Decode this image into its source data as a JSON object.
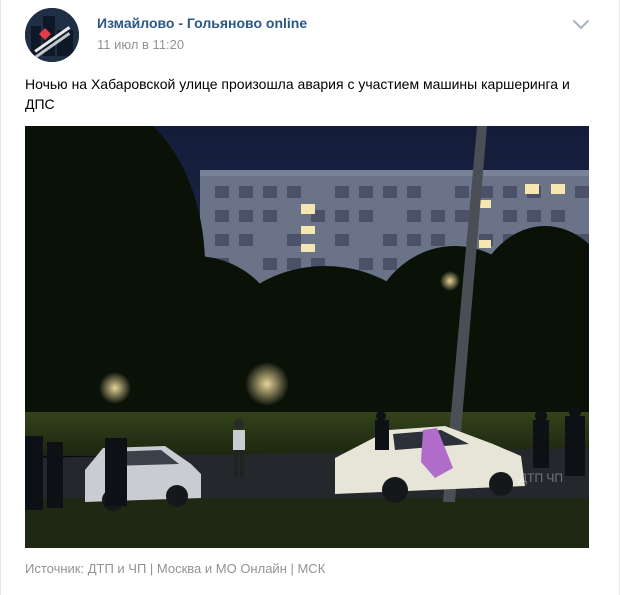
{
  "post": {
    "group_name": "Измайлово - Гольяново online",
    "date": "11 июл в 11:20",
    "text": "Ночью на Хабаровской улице произошла авария с участием машины каршеринга и ДПС",
    "source": "Источник: ДТП и ЧП | Москва и МО Онлайн | МСК"
  },
  "photo": {
    "watermark": "ДТП ЧП"
  },
  "icons": {
    "avatar": "group-avatar-icon",
    "menu": "chevron-down-icon"
  },
  "colors": {
    "link": "#2a5885",
    "muted": "#939393",
    "night_sky": "#1a2340",
    "carsharing_accent": "#b06cc8"
  }
}
